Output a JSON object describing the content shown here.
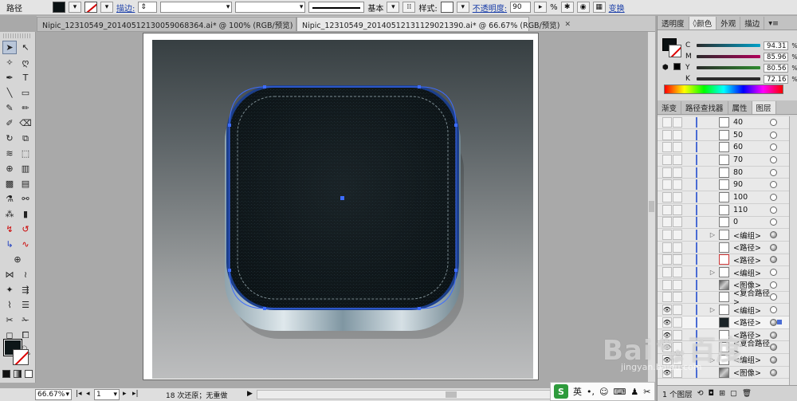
{
  "control_bar": {
    "selection_type": "路径",
    "stroke_label": "描边:",
    "stroke_profile_label": "基本",
    "style_label": "样式:",
    "opacity_label": "不透明度:",
    "opacity_value": "90",
    "opacity_unit": "%",
    "transform_link": "变换",
    "fill_color": "#0a1113"
  },
  "document_tabs": [
    {
      "label": "Nipic_12310549_20140512130059068364.ai* @ 100% (RGB/预览)",
      "active": false
    },
    {
      "label": "Nipic_12310549_20140512131129021390.ai* @ 66.67% (RGB/预览)",
      "active": true
    }
  ],
  "status_bar": {
    "zoom": "66.67%",
    "page": "1",
    "undo_text": "18 次还原；无重做"
  },
  "ime": {
    "logo": "S",
    "lang": "英"
  },
  "color_panel": {
    "tabs": [
      "透明度",
      "颜色",
      "外观",
      "描边"
    ],
    "active_tab": "颜色",
    "channels": [
      {
        "label": "C",
        "value": "94.31",
        "color": "#00a0c8"
      },
      {
        "label": "M",
        "value": "85.96",
        "color": "#b0005a"
      },
      {
        "label": "Y",
        "value": "80.56",
        "color": "#c8b400"
      },
      {
        "label": "K",
        "value": "72.16",
        "color": "#202020"
      }
    ]
  },
  "layers_panel": {
    "tabs": [
      "渐变",
      "路径查找器",
      "属性",
      "图层"
    ],
    "active_tab": "图层",
    "rows": [
      {
        "name": "40",
        "eye": false,
        "tri": false,
        "thumb": "plain",
        "target": "empty"
      },
      {
        "name": "50",
        "eye": false,
        "tri": false,
        "thumb": "plain",
        "target": "empty"
      },
      {
        "name": "60",
        "eye": false,
        "tri": false,
        "thumb": "plain",
        "target": "empty"
      },
      {
        "name": "70",
        "eye": false,
        "tri": false,
        "thumb": "plain",
        "target": "empty"
      },
      {
        "name": "80",
        "eye": false,
        "tri": false,
        "thumb": "plain",
        "target": "empty"
      },
      {
        "name": "90",
        "eye": false,
        "tri": false,
        "thumb": "plain",
        "target": "empty"
      },
      {
        "name": "100",
        "eye": false,
        "tri": false,
        "thumb": "plain",
        "target": "empty"
      },
      {
        "name": "110",
        "eye": false,
        "tri": false,
        "thumb": "plain",
        "target": "empty"
      },
      {
        "name": "0",
        "eye": false,
        "tri": false,
        "thumb": "plain",
        "target": "empty"
      },
      {
        "name": "<编组>",
        "eye": false,
        "tri": true,
        "thumb": "plain",
        "target": "filled"
      },
      {
        "name": "<路径>",
        "eye": false,
        "tri": false,
        "thumb": "plain",
        "target": "filled"
      },
      {
        "name": "<路径>",
        "eye": false,
        "tri": false,
        "thumb": "red",
        "target": "filled"
      },
      {
        "name": "<编组>",
        "eye": false,
        "tri": true,
        "thumb": "plain",
        "target": "empty"
      },
      {
        "name": "<图像>",
        "eye": false,
        "tri": false,
        "thumb": "image",
        "target": "empty"
      },
      {
        "name": "<复合路径>",
        "eye": false,
        "tri": false,
        "thumb": "plain",
        "target": "empty"
      },
      {
        "name": "<编组>",
        "eye": true,
        "tri": true,
        "thumb": "plain",
        "target": "empty"
      },
      {
        "name": "<路径>",
        "eye": true,
        "tri": false,
        "thumb": "dark",
        "target": "filled",
        "selected": true
      },
      {
        "name": "<路径>",
        "eye": true,
        "tri": false,
        "thumb": "plain",
        "target": "filled"
      },
      {
        "name": "<复合路径>",
        "eye": true,
        "tri": false,
        "thumb": "plain",
        "target": "filled"
      },
      {
        "name": "<编组>",
        "eye": true,
        "tri": true,
        "thumb": "plain",
        "target": "filled"
      },
      {
        "name": "<图像>",
        "eye": true,
        "tri": false,
        "thumb": "image",
        "target": "filled"
      }
    ],
    "footer_text": "1 个图层"
  },
  "watermark": {
    "brand": "Bai",
    "brand2": "百度",
    "sub": "jingyan.baidu.com"
  }
}
